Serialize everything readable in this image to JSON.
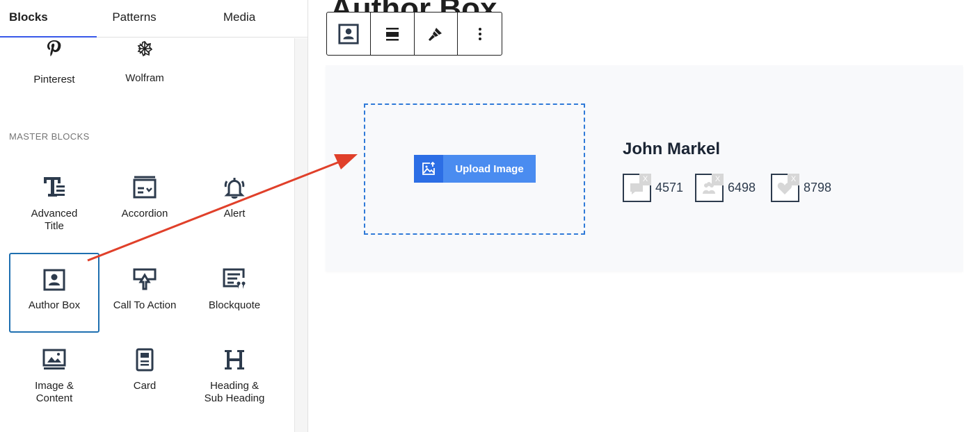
{
  "tabs": [
    {
      "label": "Blocks",
      "active": true
    },
    {
      "label": "Patterns",
      "active": false
    },
    {
      "label": "Media",
      "active": false
    }
  ],
  "embeds": [
    {
      "label": "Pinterest",
      "icon": "pinterest-icon"
    },
    {
      "label": "Wolfram",
      "icon": "wolfram-icon"
    }
  ],
  "section_heading": "MASTER BLOCKS",
  "blocks": [
    {
      "label": "Advanced\nTitle",
      "icon": "advanced-title-icon"
    },
    {
      "label": "Accordion",
      "icon": "accordion-icon"
    },
    {
      "label": "Alert",
      "icon": "bell-icon"
    },
    {
      "label": "Author Box",
      "icon": "author-box-icon",
      "selected": true
    },
    {
      "label": "Call To Action",
      "icon": "call-to-action-icon"
    },
    {
      "label": "Blockquote",
      "icon": "blockquote-icon"
    },
    {
      "label": "Image &\nContent",
      "icon": "image-content-icon"
    },
    {
      "label": "Card",
      "icon": "card-icon"
    },
    {
      "label": "Heading &\nSub Heading",
      "icon": "heading-icon"
    }
  ],
  "canvas": {
    "post_title": "Author Box"
  },
  "toolbar": {
    "buttons": [
      "author-box-icon",
      "align-icon",
      "brush-icon",
      "more-options-icon"
    ]
  },
  "author_box": {
    "upload_label": "Upload Image",
    "name": "John Markel",
    "stats": [
      {
        "icon": "comments-icon",
        "value": "4571",
        "badge": "X"
      },
      {
        "icon": "followers-icon",
        "value": "6498",
        "badge": "X"
      },
      {
        "icon": "likes-icon",
        "value": "8798",
        "badge": "X"
      }
    ]
  },
  "colors": {
    "accent": "#3858e9",
    "upload_blue": "#4a8cf0",
    "upload_dark": "#2c6ee5",
    "dash_border": "#2f7ad8",
    "arrow_red": "#e0402a",
    "icon_dark": "#2d3b4d"
  }
}
